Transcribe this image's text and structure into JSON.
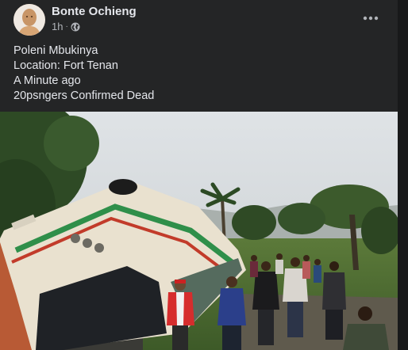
{
  "post": {
    "author": "Bonte Ochieng",
    "time": "1h",
    "separator": "·",
    "audience_icon": "globe-icon",
    "more_icon": "more-options-icon",
    "text_lines": [
      "Poleni Mbukinya",
      "Location: Fort Tenan",
      "A Minute ago",
      "20psngers Confirmed Dead"
    ]
  },
  "colors": {
    "background": "#18191a",
    "card": "#242526",
    "primary_text": "#e4e6eb",
    "secondary_text": "#b0b3b8"
  }
}
